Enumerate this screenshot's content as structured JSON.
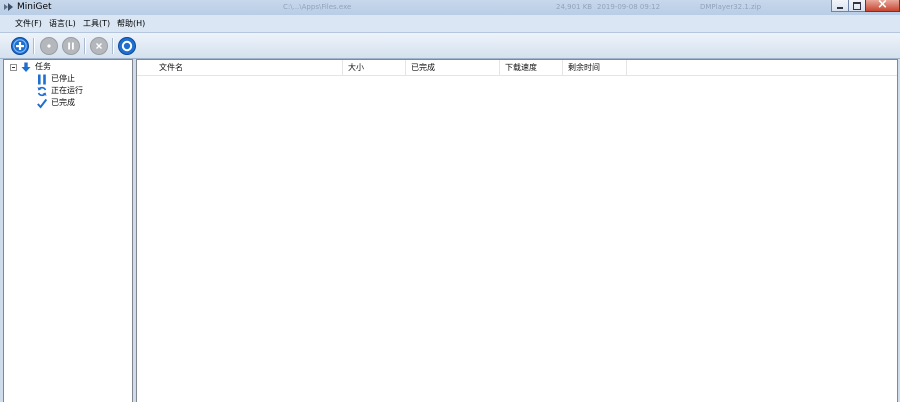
{
  "window": {
    "title": "MiniGet",
    "ghost_texts": [
      "C:\\...\\Apps\\Files.exe",
      "24,901 KB",
      "2019-09-08 09:12",
      "DMPlayer32.1.zip"
    ]
  },
  "menu": [
    {
      "label": "文件(F)"
    },
    {
      "label": "语言(L)"
    },
    {
      "label": "工具(T)"
    },
    {
      "label": "帮助(H)"
    }
  ],
  "toolbar": {
    "buttons": [
      {
        "name": "add",
        "icon": "plus-circle-icon",
        "enabled": true
      },
      {
        "name": "start",
        "icon": "play-circle-icon",
        "enabled": false
      },
      {
        "name": "pause",
        "icon": "pause-circle-icon",
        "enabled": false
      },
      {
        "name": "delete",
        "icon": "x-circle-icon",
        "enabled": false
      },
      {
        "name": "settings",
        "icon": "ring-circle-icon",
        "enabled": true
      }
    ],
    "accent": "#1f6fd0",
    "disabled": "#b4b8bd"
  },
  "tree": {
    "root": {
      "label": "任务",
      "icon": "down-arrow-icon"
    },
    "children": [
      {
        "label": "已停止",
        "icon": "pause-bars-icon"
      },
      {
        "label": "正在运行",
        "icon": "refresh-icon"
      },
      {
        "label": "已完成",
        "icon": "check-icon"
      }
    ]
  },
  "list": {
    "columns": [
      {
        "label": "文件名"
      },
      {
        "label": "大小"
      },
      {
        "label": "已完成"
      },
      {
        "label": "下载速度"
      },
      {
        "label": "剩余时间"
      }
    ],
    "rows": []
  }
}
